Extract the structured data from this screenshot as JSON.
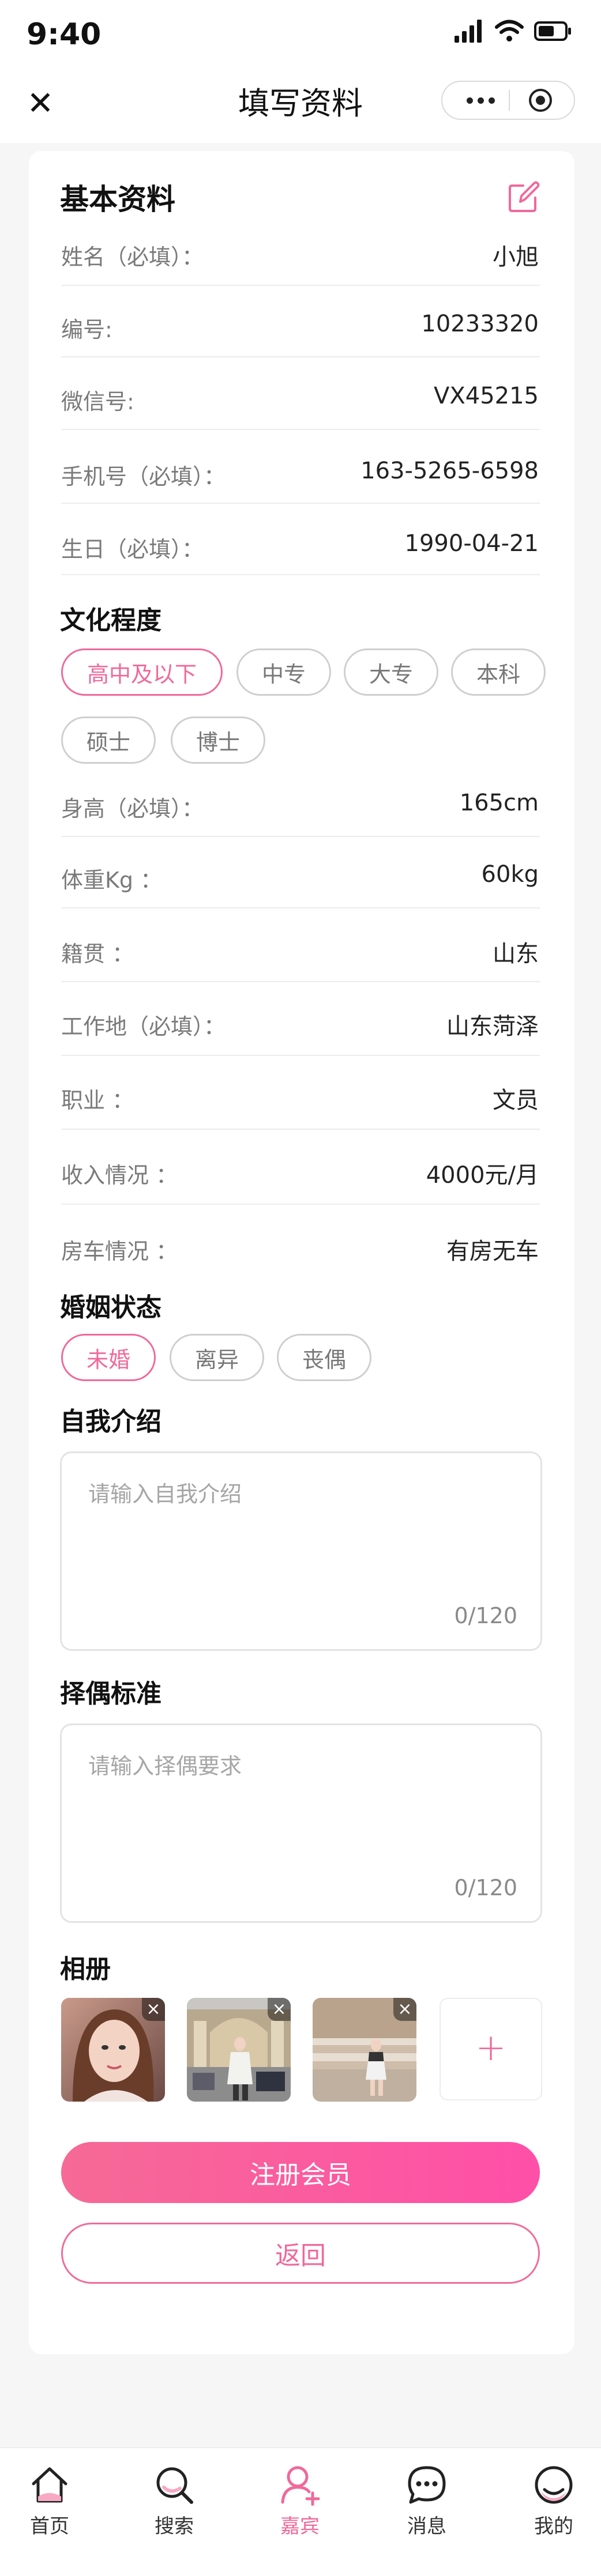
{
  "status_bar": {
    "time": "9:40"
  },
  "nav": {
    "title": "填写资料"
  },
  "basic": {
    "title": "基本资料",
    "rows": [
      {
        "label": "姓名（必填）：",
        "value": "小旭"
      },
      {
        "label": "编号:",
        "value": "10233320"
      },
      {
        "label": "微信号:",
        "value": "VX45215"
      },
      {
        "label": "手机号（必填）：",
        "value": "163-5265-6598"
      },
      {
        "label": "生日（必填）：",
        "value": "1990-04-21"
      }
    ]
  },
  "education": {
    "title": "文化程度",
    "options": [
      "高中及以下",
      "中专",
      "大专",
      "本科",
      "硕士",
      "博士"
    ],
    "selected": "高中及以下"
  },
  "details": {
    "rows": [
      {
        "label": "身高（必填）：",
        "value": "165cm"
      },
      {
        "label": "体重Kg ：",
        "value": "60kg"
      },
      {
        "label": "籍贯 ：",
        "value": "山东"
      },
      {
        "label": "工作地（必填）：",
        "value": "山东菏泽"
      },
      {
        "label": "职业 ：",
        "value": "文员"
      },
      {
        "label": "收入情况 ：",
        "value": "4000元/月"
      },
      {
        "label": "房车情况 ：",
        "value": "有房无车"
      }
    ]
  },
  "marital": {
    "title": "婚姻状态",
    "options": [
      "未婚",
      "离异",
      "丧偶"
    ],
    "selected": "未婚"
  },
  "intro": {
    "title": "自我介绍",
    "placeholder": "请输入自我介绍",
    "counter": "0/120"
  },
  "criteria": {
    "title": "择偶标准",
    "placeholder": "请输入择偶要求",
    "counter": "0/120"
  },
  "album": {
    "title": "相册",
    "delete_glyph": "×",
    "add_glyph": "+"
  },
  "buttons": {
    "register": "注册会员",
    "back": "返回"
  },
  "tabbar": {
    "items": [
      {
        "label": "首页",
        "icon": "home-icon"
      },
      {
        "label": "搜索",
        "icon": "search-icon"
      },
      {
        "label": "嘉宾",
        "icon": "guest-icon"
      },
      {
        "label": "消息",
        "icon": "message-icon"
      },
      {
        "label": "我的",
        "icon": "profile-icon"
      }
    ],
    "active": "嘉宾"
  },
  "colors": {
    "accent": "#f0699a",
    "gradient_end": "#ff4fa8",
    "background": "#f6f6f6"
  }
}
